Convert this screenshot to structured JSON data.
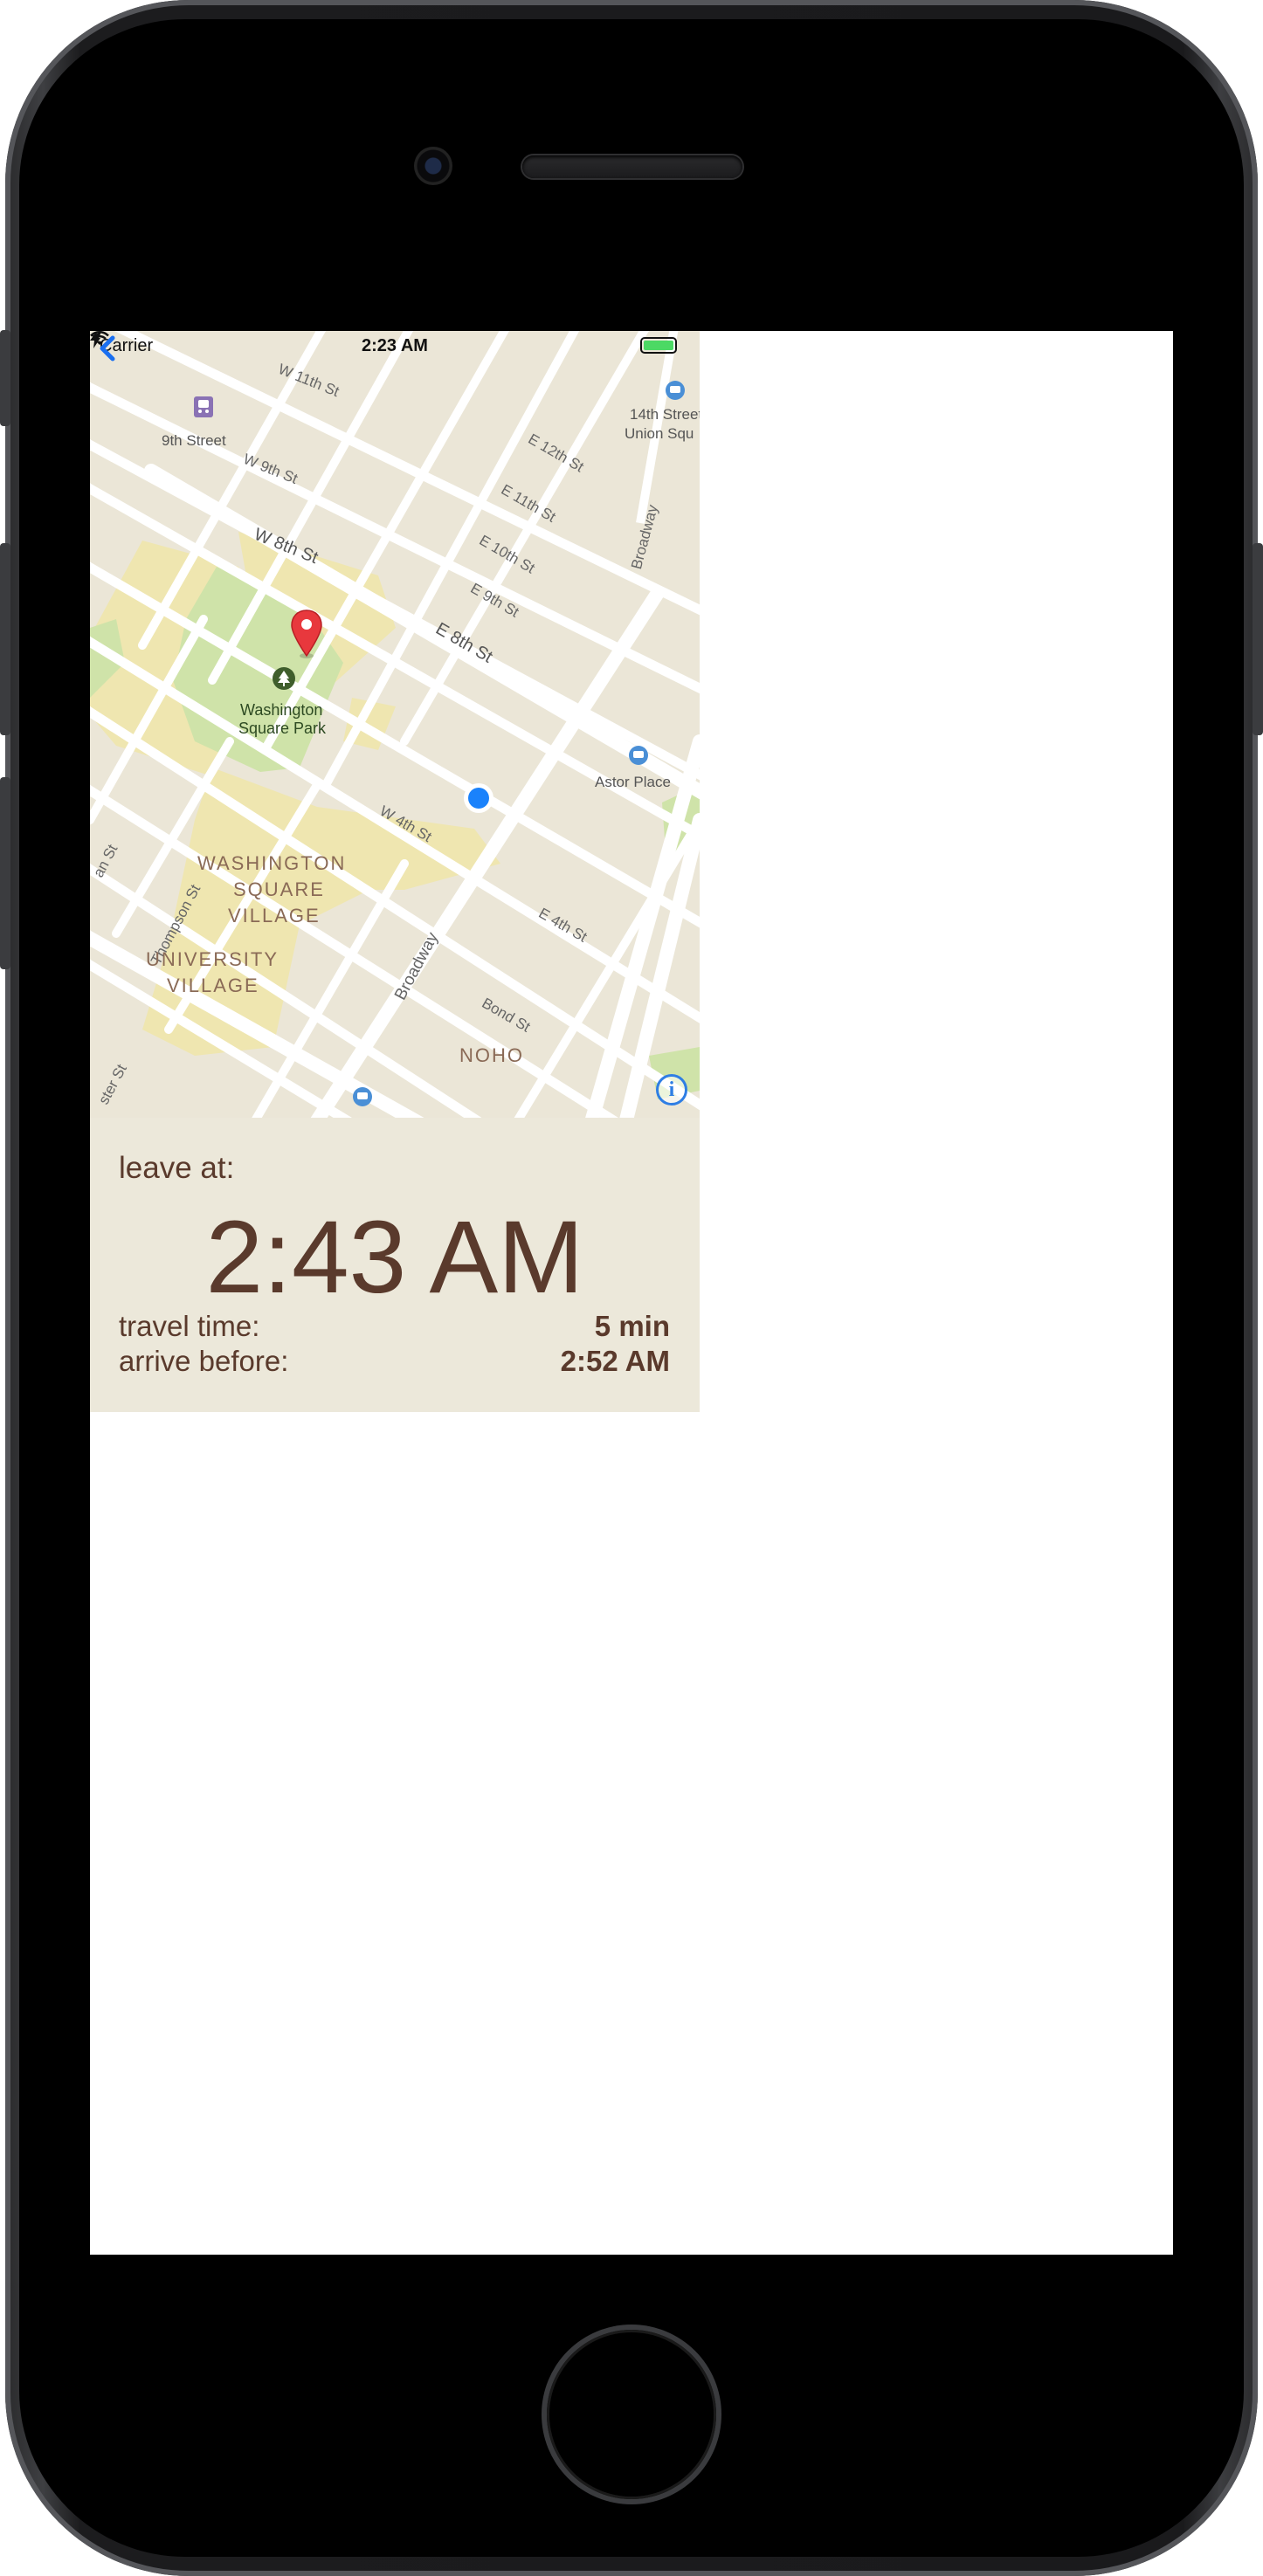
{
  "status_bar": {
    "carrier": "Carrier",
    "time": "2:23 AM",
    "battery_color": "#4cd964"
  },
  "map": {
    "labels": {
      "w11": "W 11th St",
      "ninth_street_station": "9th Street",
      "w9": "W 9th St",
      "e12": "E 12th St",
      "fourteenth_street": "14th Street",
      "union_square": "Union Squ",
      "e11": "E 11th St",
      "w8": "W 8th St",
      "e10": "E 10th St",
      "broadway_north": "Broadway",
      "e9": "E 9th St",
      "e8": "E 8th St",
      "park_line1": "Washington",
      "park_line2": "Square Park",
      "astor_place": "Astor Place",
      "w4": "W 4th St",
      "district1_line1": "WASHINGTON",
      "district1_line2": "SQUARE",
      "district1_line3": "VILLAGE",
      "thompson": "Thompson St",
      "e4": "E 4th St",
      "broadway_south": "Broadway",
      "district2_line1": "UNIVERSITY",
      "district2_line2": "VILLAGE",
      "bond": "Bond St",
      "noho": "NOHO",
      "edge_left_st": "an St",
      "edge_bottom_st": "ster St"
    },
    "icons": {
      "destination_pin": "map-pin-icon",
      "current_location": "current-location-dot-icon",
      "park_icon": "tree-icon",
      "transit_icon": "train-icon",
      "info_button": "info-icon",
      "back_button": "chevron-left-icon"
    },
    "colors": {
      "background": "#ebe6d7",
      "roads": "#ffffff",
      "park": "#cfe3a9",
      "campus": "#efe6b0",
      "pin": "#e8383d",
      "user_location": "#1a82fb"
    },
    "info_glyph": "i"
  },
  "panel": {
    "leave_label": "leave at:",
    "leave_time": "2:43 AM",
    "travel_label": "travel time:",
    "travel_value": "5 min",
    "arrive_label": "arrive before:",
    "arrive_value": "2:52 AM",
    "text_color": "#5a3a2c",
    "background": "#ece8da"
  }
}
